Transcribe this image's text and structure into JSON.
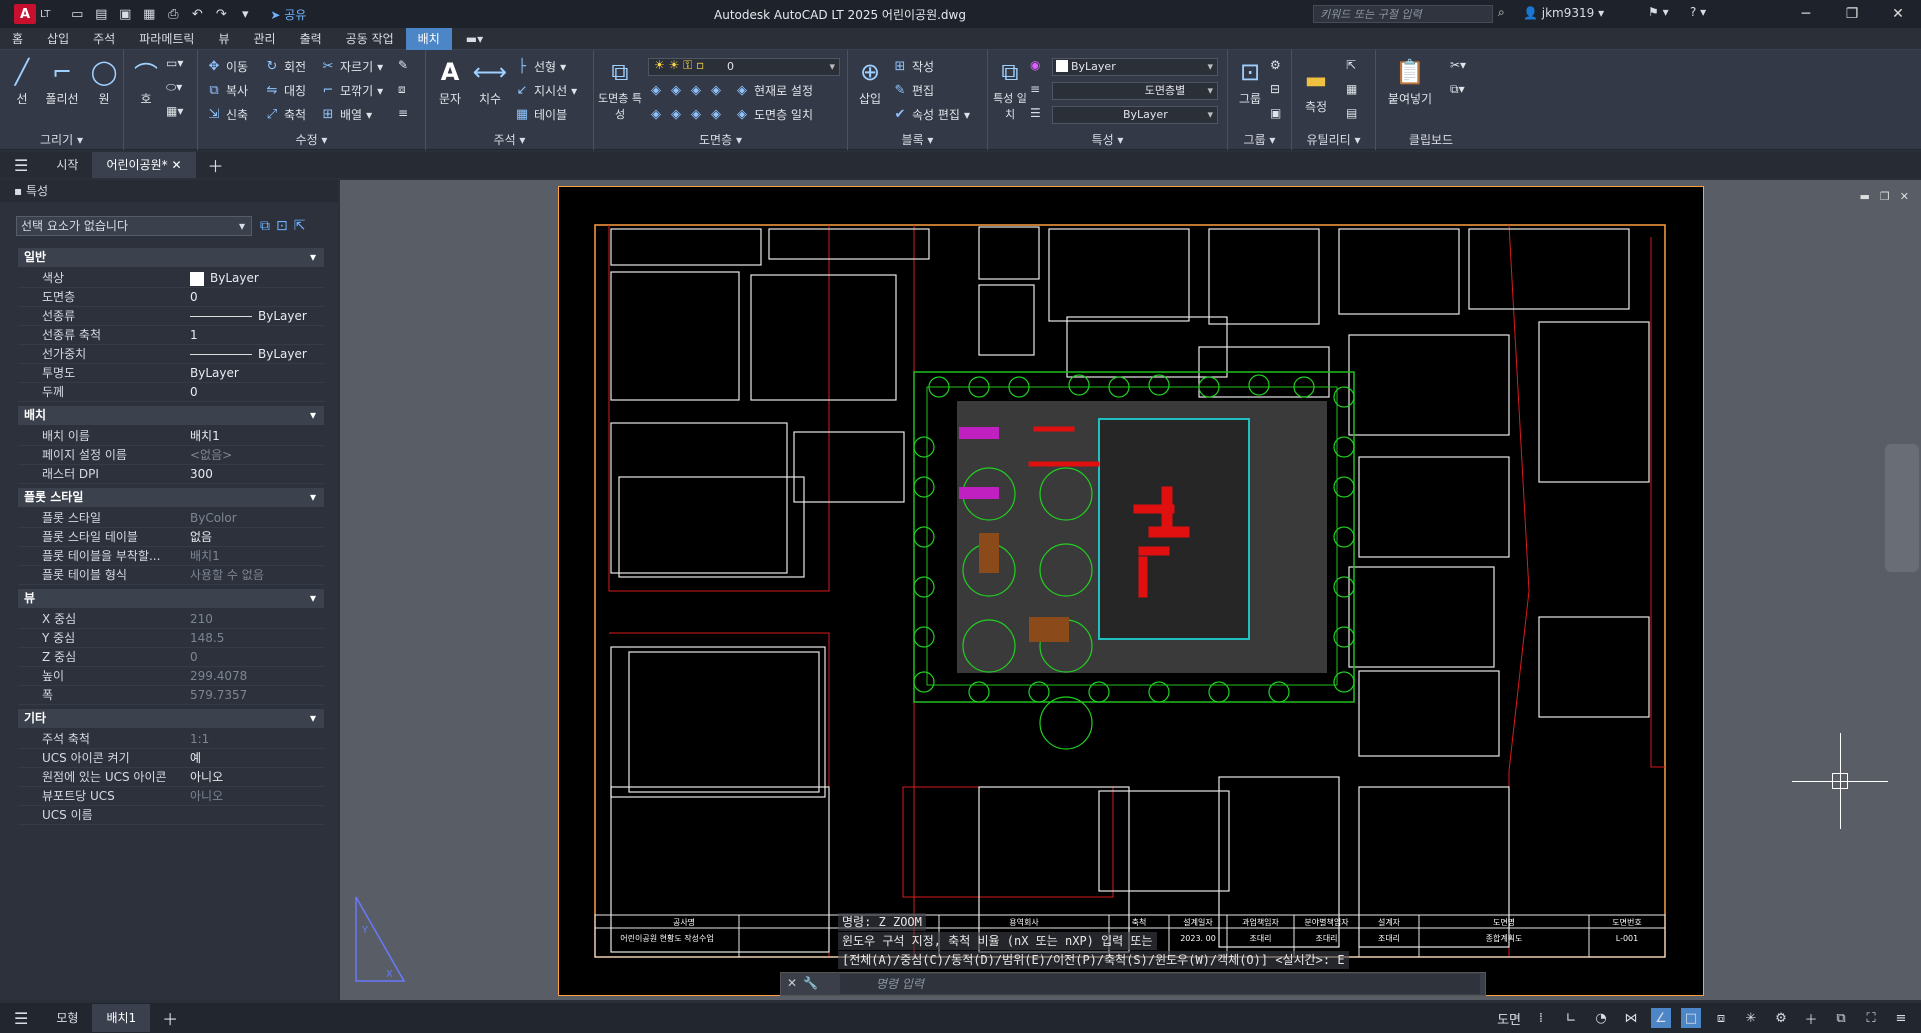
{
  "titlebar": {
    "logo": "A",
    "lt": "LT",
    "share": "공유",
    "title": "Autodesk AutoCAD LT 2025    어린이공원.dwg",
    "search_placeholder": "키워드 또는 구절 입력",
    "user": "jkm9319"
  },
  "ribbon_tabs": [
    "홈",
    "삽입",
    "주석",
    "파라메트릭",
    "뷰",
    "관리",
    "출력",
    "공동 작업",
    "배치"
  ],
  "ribbon": {
    "draw": {
      "title": "그리기 ▾",
      "line": "선",
      "polyline": "폴리선",
      "circle": "원",
      "arc": "호"
    },
    "modify": {
      "title": "수정 ▾",
      "move": "이동",
      "rotate": "회전",
      "trim": "자르기",
      "copy": "복사",
      "mirror": "대칭",
      "fillet": "모깎기",
      "stretch": "신축",
      "scale": "축척",
      "array": "배열"
    },
    "annotation": {
      "title": "주석 ▾",
      "text": "문자",
      "dim": "치수",
      "linear": "선형",
      "leader": "지시선",
      "table": "테이블"
    },
    "layers": {
      "title": "도면층 ▾",
      "props": "도면층 특성",
      "layer_value": "0",
      "set_current": "현재로 설정",
      "match": "도면층 일치"
    },
    "block": {
      "title": "블록 ▾",
      "insert": "삽입",
      "create": "작성",
      "edit": "편집",
      "attr_edit": "속성 편집"
    },
    "properties": {
      "title": "특성 ▾",
      "match": "특성 일치",
      "color": "ByLayer",
      "linetype": "도면층별",
      "lineweight": "ByLayer"
    },
    "groups": {
      "title": "그룹 ▾",
      "group": "그룹"
    },
    "utilities": {
      "title": "유틸리티 ▾",
      "measure": "측정"
    },
    "clipboard": {
      "title": "클립보드",
      "paste": "붙여넣기"
    }
  },
  "doc_tabs": {
    "start": "시작",
    "current": "어린이공원*"
  },
  "properties_panel": {
    "header": "특성",
    "selection": "선택 요소가 없습니다",
    "sections": [
      {
        "title": "일반",
        "rows": [
          {
            "k": "색상",
            "v": "ByLayer",
            "kind": "swatch"
          },
          {
            "k": "도면층",
            "v": "0"
          },
          {
            "k": "선종류",
            "v": "ByLayer",
            "kind": "line"
          },
          {
            "k": "선종류 축척",
            "v": "1"
          },
          {
            "k": "선가중치",
            "v": "ByLayer",
            "kind": "line"
          },
          {
            "k": "투명도",
            "v": "ByLayer"
          },
          {
            "k": "두께",
            "v": "0"
          }
        ]
      },
      {
        "title": "배치",
        "rows": [
          {
            "k": "배치 이름",
            "v": "배치1"
          },
          {
            "k": "페이지 설정 이름",
            "v": "<없음>",
            "dim": true
          },
          {
            "k": "래스터 DPI",
            "v": "300"
          }
        ]
      },
      {
        "title": "플롯 스타일",
        "rows": [
          {
            "k": "플롯 스타일",
            "v": "ByColor",
            "dim": true
          },
          {
            "k": "플롯 스타일 테이블",
            "v": "없음"
          },
          {
            "k": "플롯 테이블을 부착할...",
            "v": "배치1",
            "dim": true
          },
          {
            "k": "플롯 테이블 형식",
            "v": "사용할 수 없음",
            "dim": true
          }
        ]
      },
      {
        "title": "뷰",
        "rows": [
          {
            "k": "X 중심",
            "v": "210",
            "dim": true
          },
          {
            "k": "Y 중심",
            "v": "148.5",
            "dim": true
          },
          {
            "k": "Z 중심",
            "v": "0",
            "dim": true
          },
          {
            "k": "높이",
            "v": "299.4078",
            "dim": true
          },
          {
            "k": "폭",
            "v": "579.7357",
            "dim": true
          }
        ]
      },
      {
        "title": "기타",
        "rows": [
          {
            "k": "주석 축척",
            "v": "1:1",
            "dim": true
          },
          {
            "k": "UCS 아이콘 켜기",
            "v": "예"
          },
          {
            "k": "원점에 있는 UCS 아이콘",
            "v": "아니오"
          },
          {
            "k": "뷰포트당 UCS",
            "v": "아니오",
            "dim": true
          },
          {
            "k": "UCS 이름",
            "v": ""
          }
        ]
      }
    ]
  },
  "title_block": {
    "h1": "공사명",
    "h2": "용역회사",
    "h3": "축척",
    "h4": "설계일자",
    "h5": "과업책임자",
    "h6": "분야별책임자",
    "h7": "설계자",
    "h8": "도면명",
    "h9": "도면번호",
    "v1": "어린이공원 현황도 작성수업",
    "v4": "2023. 00",
    "v5": "조대리",
    "v6": "조대리",
    "v7": "조대리",
    "v8": "종합계획도",
    "v9": "L-001"
  },
  "command": {
    "hist1": "명령: Z ZOOM",
    "hist2": "윈도우 구석 지정, 축척 비율 (nX 또는 nXP) 입력 또는",
    "hist3": "[전체(A)/중심(C)/동적(D)/범위(E)/이전(P)/축척(S)/윈도우(W)/객체(O)] <실시간>: E",
    "placeholder": "명령 입력"
  },
  "status": {
    "model": "모형",
    "layout": "배치1",
    "paper": "도면"
  }
}
